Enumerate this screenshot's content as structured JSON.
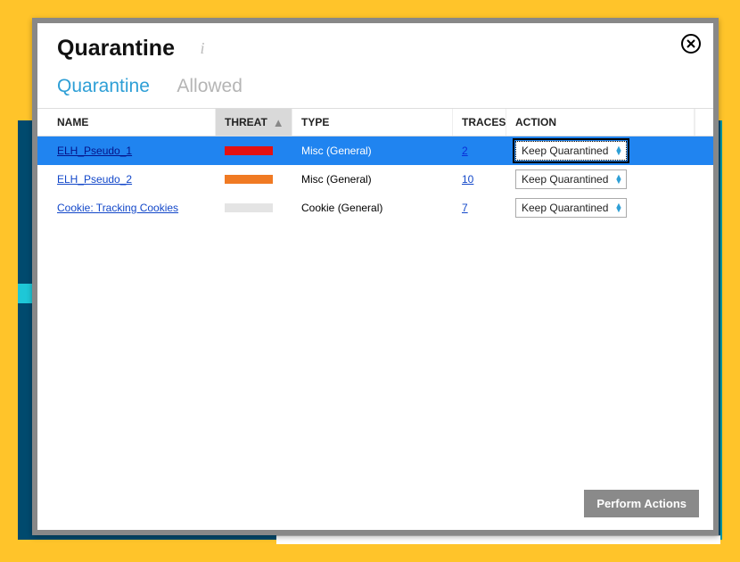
{
  "modal": {
    "title": "Quarantine",
    "close_label": "Close"
  },
  "tabs": {
    "quarantine": "Quarantine",
    "allowed": "Allowed"
  },
  "columns": {
    "name": "NAME",
    "threat": "THREAT",
    "type": "TYPE",
    "traces": "TRACES",
    "action": "ACTION"
  },
  "actions": {
    "keep_quarantined": "Keep Quarantined",
    "perform": "Perform Actions"
  },
  "rows": [
    {
      "name": "ELH_Pseudo_1",
      "threat_color": "#e41111",
      "type": "Misc (General)",
      "traces": "2",
      "action": "Keep Quarantined",
      "selected": true
    },
    {
      "name": "ELH_Pseudo_2",
      "threat_color": "#f07a23",
      "type": "Misc (General)",
      "traces": "10",
      "action": "Keep Quarantined",
      "selected": false
    },
    {
      "name": "Cookie: Tracking Cookies",
      "threat_color": "#e4e4e4",
      "type": "Cookie (General)",
      "traces": "7",
      "action": "Keep Quarantined",
      "selected": false
    }
  ]
}
